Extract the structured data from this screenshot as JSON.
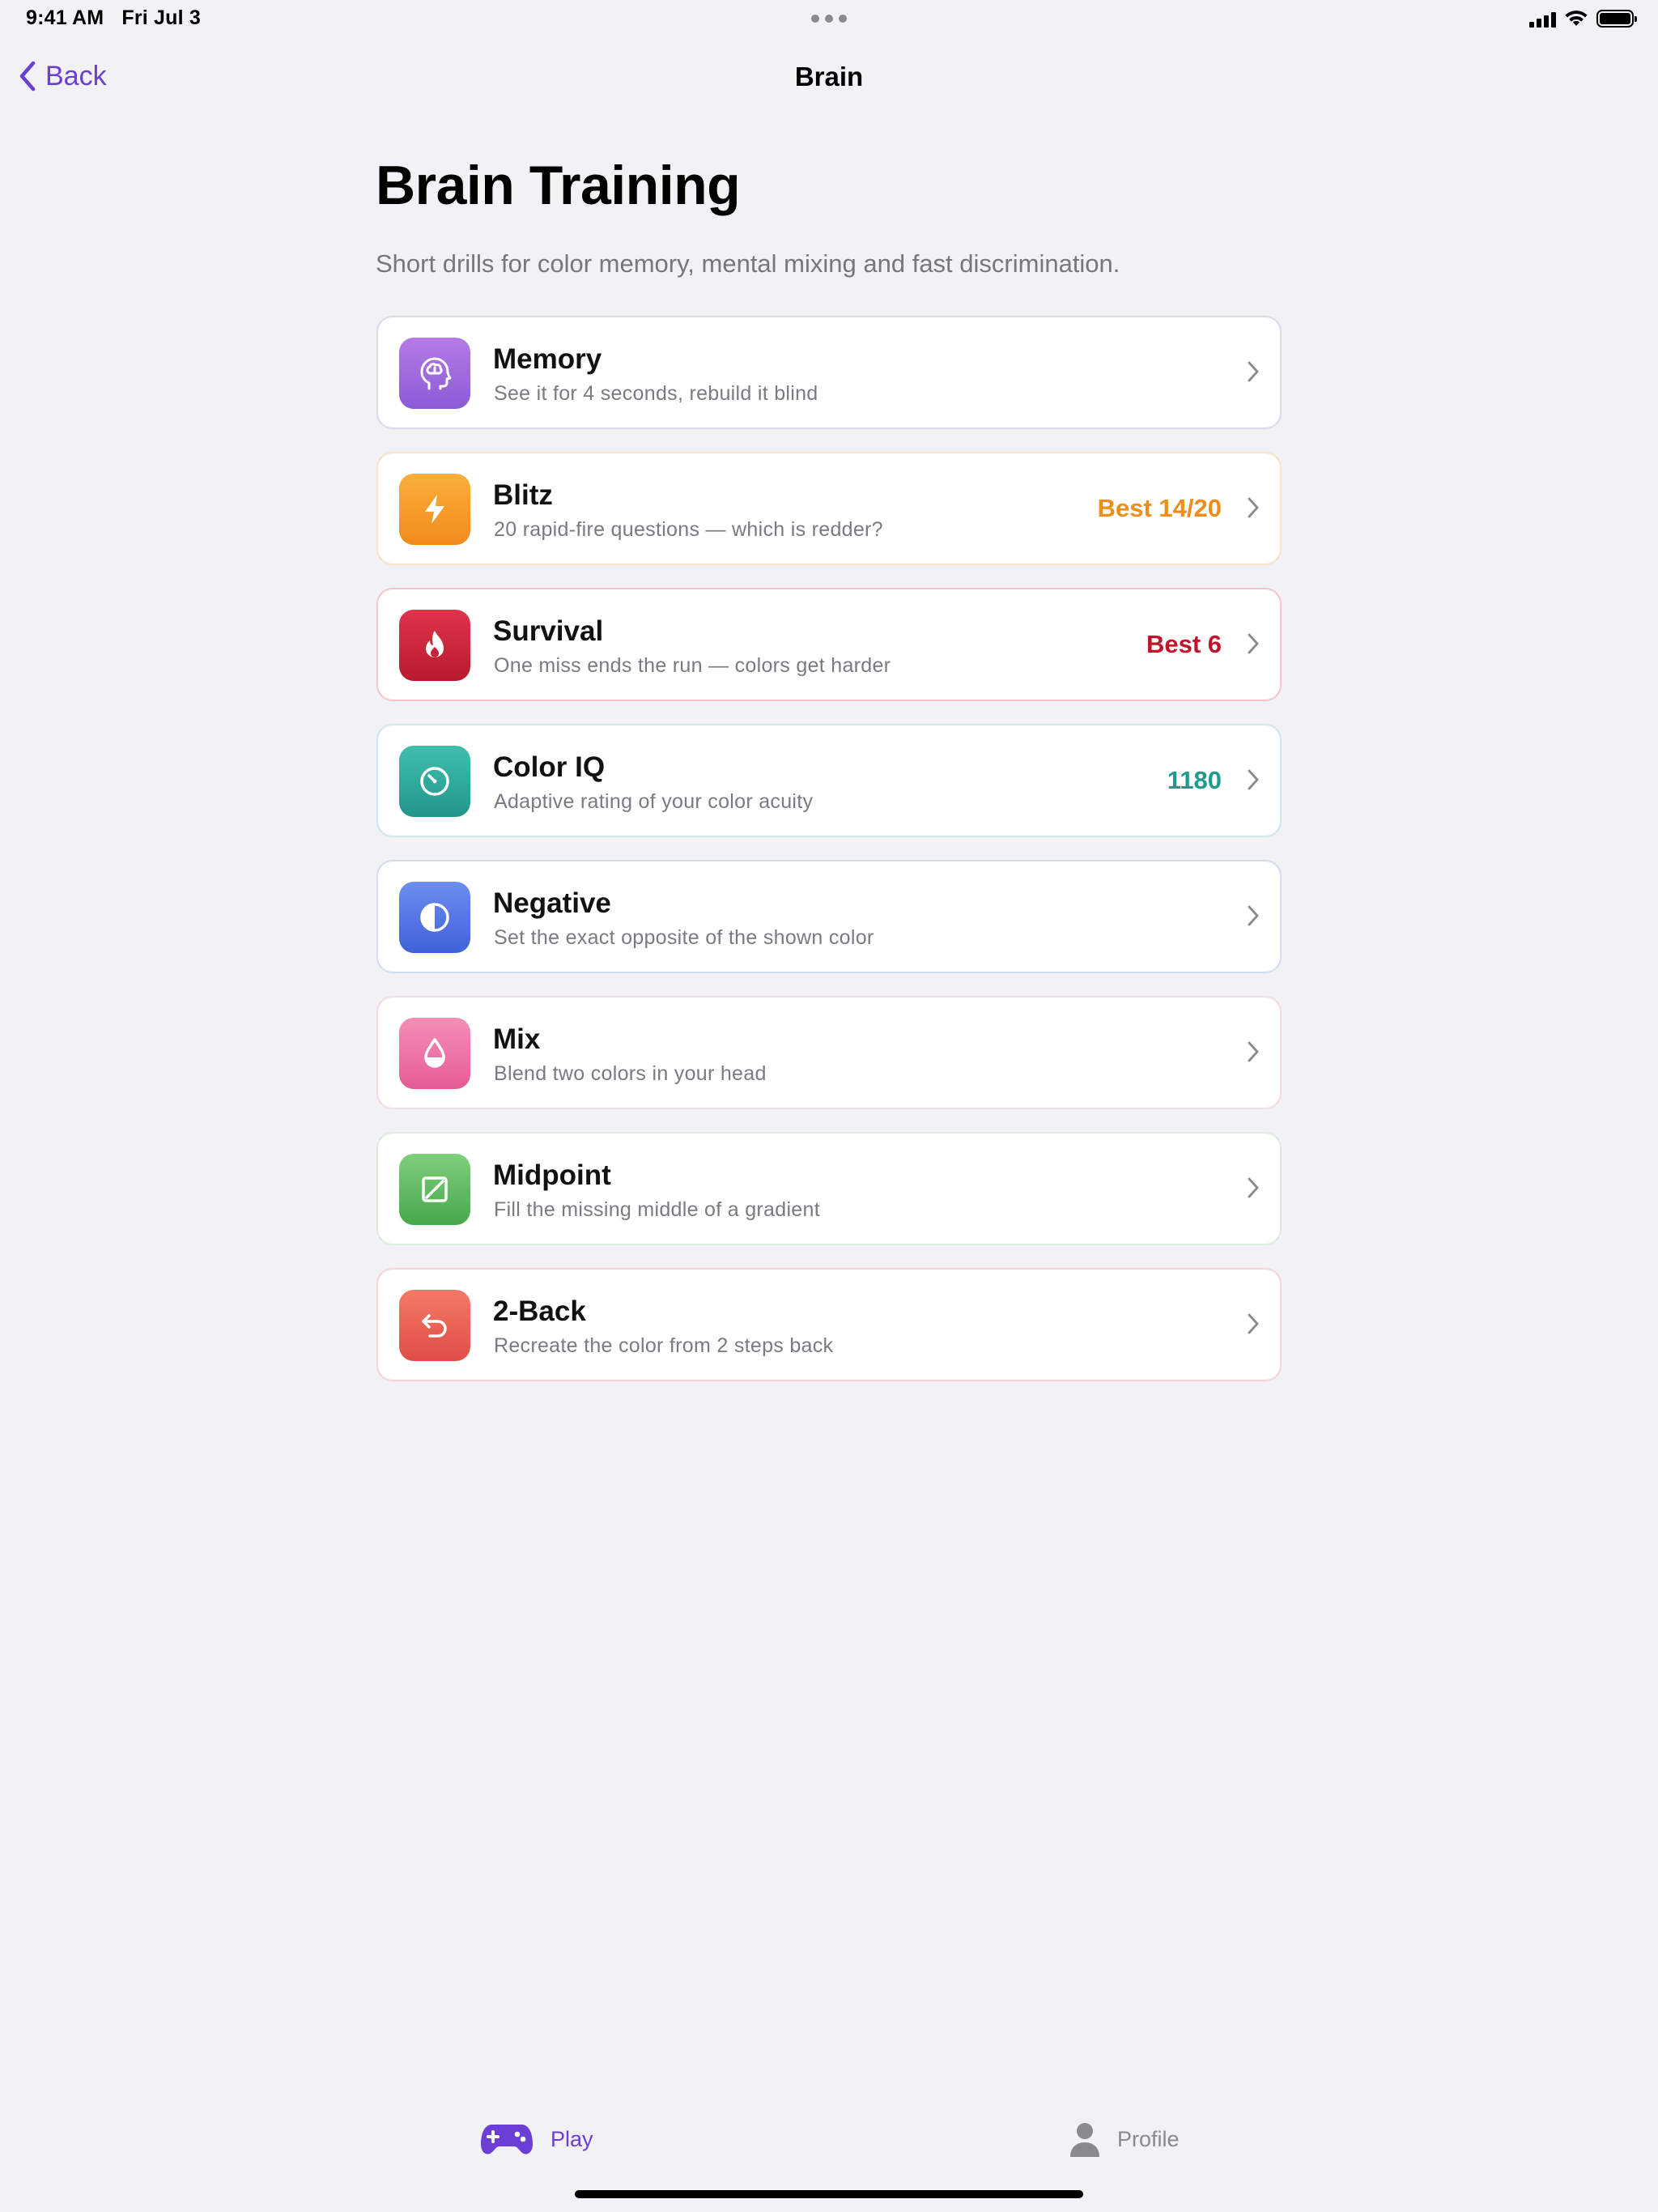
{
  "status_bar": {
    "time": "9:41 AM",
    "date": "Fri Jul 3"
  },
  "nav": {
    "back_label": "Back",
    "title": "Brain"
  },
  "header": {
    "title": "Brain Training",
    "subtitle": "Short drills for color memory, mental mixing and fast discrimination."
  },
  "modes": [
    {
      "name": "Memory",
      "description": "See it for 4 seconds, rebuild it blind",
      "score": "",
      "icon": "brain-head-icon",
      "colors": [
        "#b57ae6",
        "#8b5bd6"
      ],
      "border": "#dcdbe9"
    },
    {
      "name": "Blitz",
      "description": "20 rapid-fire questions — which is redder?",
      "score": "Best 14/20",
      "icon": "lightning-icon",
      "colors": [
        "#fbb03b",
        "#f28a1e"
      ],
      "border": "#f9e2c6",
      "score_color": "#f08c17"
    },
    {
      "name": "Survival",
      "description": "One miss ends the run — colors get harder",
      "score": "Best 6",
      "icon": "flame-icon",
      "colors": [
        "#e0344c",
        "#b71a2e"
      ],
      "border": "#f2c6cc",
      "score_color": "#c1142b"
    },
    {
      "name": "Color IQ",
      "description": "Adaptive rating of your color acuity",
      "score": "1180",
      "icon": "gauge-icon",
      "colors": [
        "#3fbfae",
        "#23968b"
      ],
      "border": "#cfe6ee",
      "score_color": "#1f9a8e"
    },
    {
      "name": "Negative",
      "description": "Set the exact opposite of the shown color",
      "score": "",
      "icon": "contrast-icon",
      "colors": [
        "#6e8df0",
        "#3f62d8"
      ],
      "border": "#d3dcf1"
    },
    {
      "name": "Mix",
      "description": "Blend two colors in your head",
      "score": "",
      "icon": "drop-icon",
      "colors": [
        "#f58fb8",
        "#e45c95"
      ],
      "border": "#f3dbe6"
    },
    {
      "name": "Midpoint",
      "description": "Fill the missing middle of a gradient",
      "score": "",
      "icon": "gradient-square-icon",
      "colors": [
        "#7fcf7a",
        "#47a84c"
      ],
      "border": "#d9ecdc"
    },
    {
      "name": "2-Back",
      "description": "Recreate the color from 2 steps back",
      "score": "",
      "icon": "undo-arrow-icon",
      "colors": [
        "#f57a66",
        "#e04d45"
      ],
      "border": "#f4d7d4"
    }
  ],
  "tabs": {
    "play_label": "Play",
    "profile_label": "Profile"
  },
  "colors": {
    "accent": "#6b3fd6",
    "background": "#f2f1f6"
  }
}
